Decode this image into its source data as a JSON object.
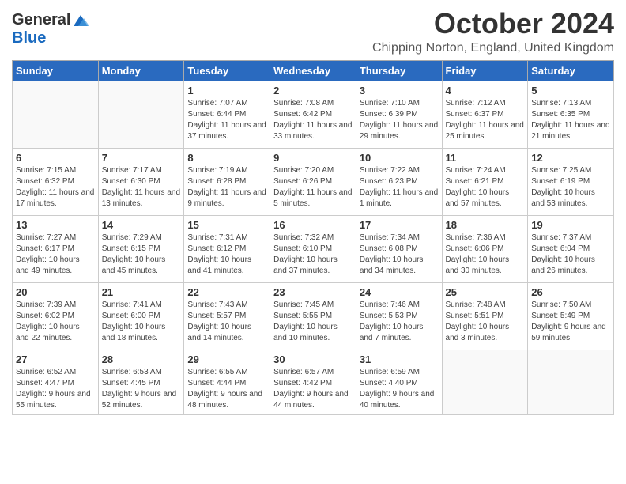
{
  "logo": {
    "general": "General",
    "blue": "Blue"
  },
  "title": "October 2024",
  "subtitle": "Chipping Norton, England, United Kingdom",
  "days_of_week": [
    "Sunday",
    "Monday",
    "Tuesday",
    "Wednesday",
    "Thursday",
    "Friday",
    "Saturday"
  ],
  "weeks": [
    [
      {
        "day": "",
        "info": ""
      },
      {
        "day": "",
        "info": ""
      },
      {
        "day": "1",
        "info": "Sunrise: 7:07 AM\nSunset: 6:44 PM\nDaylight: 11 hours and 37 minutes."
      },
      {
        "day": "2",
        "info": "Sunrise: 7:08 AM\nSunset: 6:42 PM\nDaylight: 11 hours and 33 minutes."
      },
      {
        "day": "3",
        "info": "Sunrise: 7:10 AM\nSunset: 6:39 PM\nDaylight: 11 hours and 29 minutes."
      },
      {
        "day": "4",
        "info": "Sunrise: 7:12 AM\nSunset: 6:37 PM\nDaylight: 11 hours and 25 minutes."
      },
      {
        "day": "5",
        "info": "Sunrise: 7:13 AM\nSunset: 6:35 PM\nDaylight: 11 hours and 21 minutes."
      }
    ],
    [
      {
        "day": "6",
        "info": "Sunrise: 7:15 AM\nSunset: 6:32 PM\nDaylight: 11 hours and 17 minutes."
      },
      {
        "day": "7",
        "info": "Sunrise: 7:17 AM\nSunset: 6:30 PM\nDaylight: 11 hours and 13 minutes."
      },
      {
        "day": "8",
        "info": "Sunrise: 7:19 AM\nSunset: 6:28 PM\nDaylight: 11 hours and 9 minutes."
      },
      {
        "day": "9",
        "info": "Sunrise: 7:20 AM\nSunset: 6:26 PM\nDaylight: 11 hours and 5 minutes."
      },
      {
        "day": "10",
        "info": "Sunrise: 7:22 AM\nSunset: 6:23 PM\nDaylight: 11 hours and 1 minute."
      },
      {
        "day": "11",
        "info": "Sunrise: 7:24 AM\nSunset: 6:21 PM\nDaylight: 10 hours and 57 minutes."
      },
      {
        "day": "12",
        "info": "Sunrise: 7:25 AM\nSunset: 6:19 PM\nDaylight: 10 hours and 53 minutes."
      }
    ],
    [
      {
        "day": "13",
        "info": "Sunrise: 7:27 AM\nSunset: 6:17 PM\nDaylight: 10 hours and 49 minutes."
      },
      {
        "day": "14",
        "info": "Sunrise: 7:29 AM\nSunset: 6:15 PM\nDaylight: 10 hours and 45 minutes."
      },
      {
        "day": "15",
        "info": "Sunrise: 7:31 AM\nSunset: 6:12 PM\nDaylight: 10 hours and 41 minutes."
      },
      {
        "day": "16",
        "info": "Sunrise: 7:32 AM\nSunset: 6:10 PM\nDaylight: 10 hours and 37 minutes."
      },
      {
        "day": "17",
        "info": "Sunrise: 7:34 AM\nSunset: 6:08 PM\nDaylight: 10 hours and 34 minutes."
      },
      {
        "day": "18",
        "info": "Sunrise: 7:36 AM\nSunset: 6:06 PM\nDaylight: 10 hours and 30 minutes."
      },
      {
        "day": "19",
        "info": "Sunrise: 7:37 AM\nSunset: 6:04 PM\nDaylight: 10 hours and 26 minutes."
      }
    ],
    [
      {
        "day": "20",
        "info": "Sunrise: 7:39 AM\nSunset: 6:02 PM\nDaylight: 10 hours and 22 minutes."
      },
      {
        "day": "21",
        "info": "Sunrise: 7:41 AM\nSunset: 6:00 PM\nDaylight: 10 hours and 18 minutes."
      },
      {
        "day": "22",
        "info": "Sunrise: 7:43 AM\nSunset: 5:57 PM\nDaylight: 10 hours and 14 minutes."
      },
      {
        "day": "23",
        "info": "Sunrise: 7:45 AM\nSunset: 5:55 PM\nDaylight: 10 hours and 10 minutes."
      },
      {
        "day": "24",
        "info": "Sunrise: 7:46 AM\nSunset: 5:53 PM\nDaylight: 10 hours and 7 minutes."
      },
      {
        "day": "25",
        "info": "Sunrise: 7:48 AM\nSunset: 5:51 PM\nDaylight: 10 hours and 3 minutes."
      },
      {
        "day": "26",
        "info": "Sunrise: 7:50 AM\nSunset: 5:49 PM\nDaylight: 9 hours and 59 minutes."
      }
    ],
    [
      {
        "day": "27",
        "info": "Sunrise: 6:52 AM\nSunset: 4:47 PM\nDaylight: 9 hours and 55 minutes."
      },
      {
        "day": "28",
        "info": "Sunrise: 6:53 AM\nSunset: 4:45 PM\nDaylight: 9 hours and 52 minutes."
      },
      {
        "day": "29",
        "info": "Sunrise: 6:55 AM\nSunset: 4:44 PM\nDaylight: 9 hours and 48 minutes."
      },
      {
        "day": "30",
        "info": "Sunrise: 6:57 AM\nSunset: 4:42 PM\nDaylight: 9 hours and 44 minutes."
      },
      {
        "day": "31",
        "info": "Sunrise: 6:59 AM\nSunset: 4:40 PM\nDaylight: 9 hours and 40 minutes."
      },
      {
        "day": "",
        "info": ""
      },
      {
        "day": "",
        "info": ""
      }
    ]
  ]
}
